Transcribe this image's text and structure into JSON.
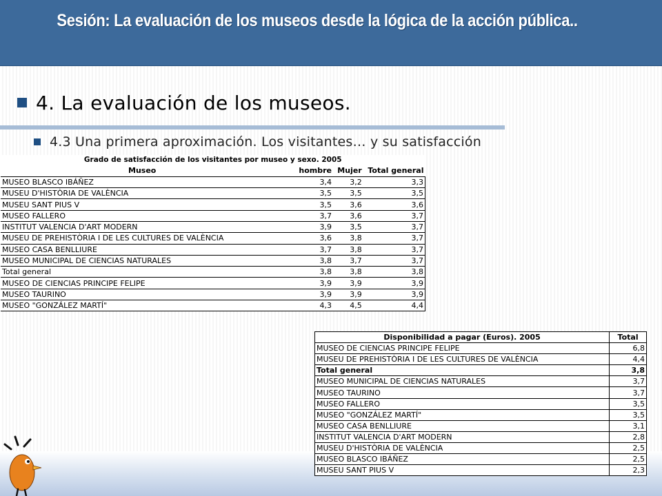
{
  "header": {
    "title": "Sesión:  La evaluación de los museos desde la lógica de la acción pública.."
  },
  "main": {
    "heading": "4. La evaluación de los museos.",
    "subheading": "4.3 Una primera aproximación. Los visitantes… y su satisfacción"
  },
  "table_satisfaction": {
    "title": "Grado de satisfacción de los visitantes por museo y sexo. 2005",
    "columns": [
      "Museo",
      "hombre",
      "Mujer",
      "Total general"
    ],
    "rows": [
      [
        "MUSEO BLASCO IBÁÑEZ",
        "3,4",
        "3,2",
        "3,3"
      ],
      [
        "MUSEU D'HISTÒRIA DE VALÈNCIA",
        "3,5",
        "3,5",
        "3,5"
      ],
      [
        "MUSEU SANT PIUS V",
        "3,5",
        "3,6",
        "3,6"
      ],
      [
        "MUSEO FALLERO",
        "3,7",
        "3,6",
        "3,7"
      ],
      [
        "INSTITUT VALENCIA D'ART MODERN",
        "3,9",
        "3,5",
        "3,7"
      ],
      [
        "MUSEU DE PREHISTÒRIA I DE LES CULTURES DE VALÈNCIA",
        "3,6",
        "3,8",
        "3,7"
      ],
      [
        "MUSEO CASA BENLLIURE",
        "3,7",
        "3,8",
        "3,7"
      ],
      [
        "MUSEO MUNICIPAL DE CIENCIAS NATURALES",
        "3,8",
        "3,7",
        "3,7"
      ],
      [
        "Total general",
        "3,8",
        "3,8",
        "3,8"
      ],
      [
        "MUSEO DE CIENCIAS PRINCIPE FELIPE",
        "3,9",
        "3,9",
        "3,9"
      ],
      [
        "MUSEO TAURINO",
        "3,9",
        "3,9",
        "3,9"
      ],
      [
        "MUSEO \"GONZÁLEZ MARTÍ\"",
        "4,3",
        "4,5",
        "4,4"
      ]
    ]
  },
  "table_payment": {
    "columns": [
      "Disponibilidad a pagar (Euros). 2005",
      "Total"
    ],
    "rows": [
      [
        "MUSEO DE CIENCIAS PRINCIPE FELIPE",
        "6,8"
      ],
      [
        "MUSEU DE PREHISTÒRIA I DE LES CULTURES DE VALÈNCIA",
        "4,4"
      ],
      [
        "Total general",
        "3,8"
      ],
      [
        "MUSEO MUNICIPAL DE CIENCIAS NATURALES",
        "3,7"
      ],
      [
        "MUSEO TAURINO",
        "3,7"
      ],
      [
        "MUSEO FALLERO",
        "3,5"
      ],
      [
        "MUSEO \"GONZÁLEZ MARTÍ\"",
        "3,5"
      ],
      [
        "MUSEO CASA BENLLIURE",
        "3,1"
      ],
      [
        "INSTITUT VALENCIA D'ART MODERN",
        "2,8"
      ],
      [
        "MUSEU D'HISTÒRIA DE VALÈNCIA",
        "2,5"
      ],
      [
        "MUSEO BLASCO IBÁÑEZ",
        "2,5"
      ],
      [
        "MUSEU SANT PIUS V",
        "2,3"
      ]
    ]
  },
  "colors": {
    "header_bg": "#3d6a9b",
    "bullet": "#1f4f83",
    "rule": "#a6bcd6",
    "mascot_body": "#e8821e"
  },
  "icons": {
    "mascot": "orange-bird-mascot-icon"
  }
}
